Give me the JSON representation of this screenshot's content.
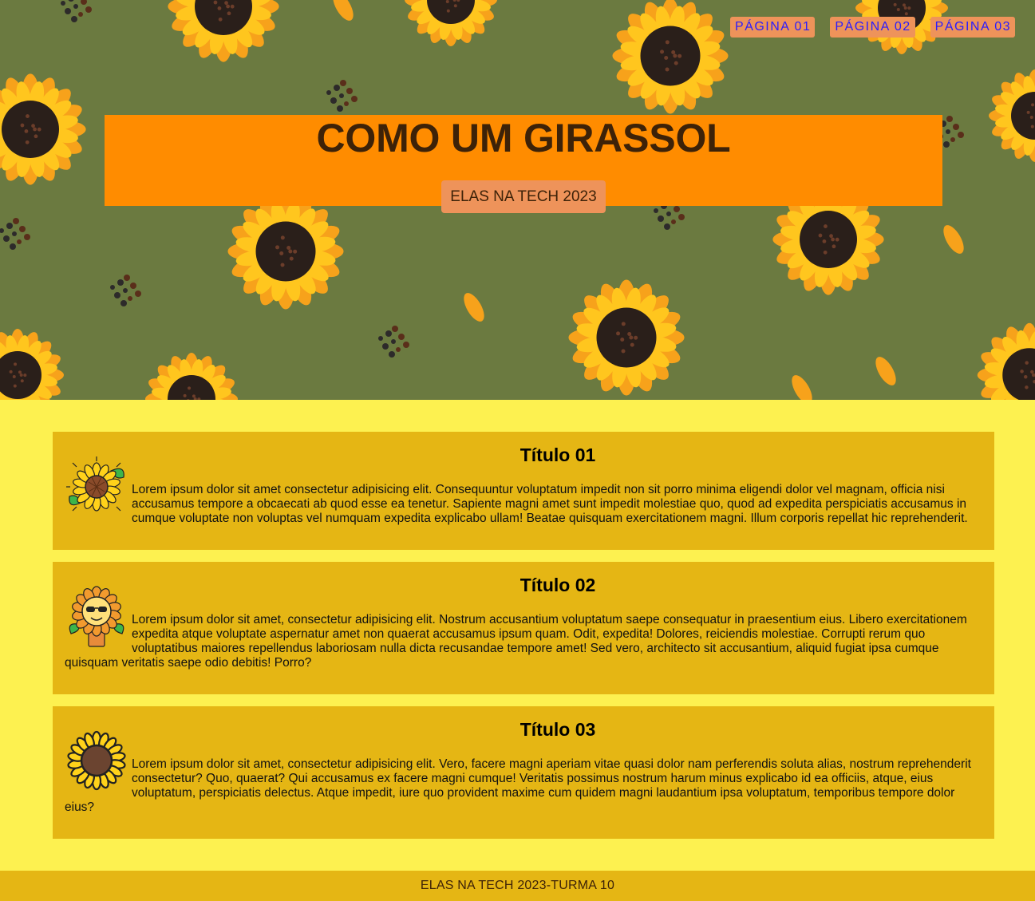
{
  "nav": [
    "PÁGINA 01",
    "PÁGINA 02",
    "PÁGINA 03"
  ],
  "hero": {
    "title": "COMO UM GIRASSOL",
    "badge": "ELAS NA TECH 2023"
  },
  "cards": [
    {
      "title": "Título 01",
      "icon": "sunflower-sparkle-icon",
      "text": "Lorem ipsum dolor sit amet consectetur adipisicing elit. Consequuntur voluptatum impedit non sit porro minima eligendi dolor vel magnam, officia nisi accusamus tempore a obcaecati ab quod esse ea tenetur. Sapiente magni amet sunt impedit molestiae quo, quod ad expedita perspiciatis accusamus in cumque voluptate non voluptas vel numquam expedita explicabo ullam! Beatae quisquam exercitationem magni. Illum corporis repellat hic reprehenderit."
    },
    {
      "title": "Título 02",
      "icon": "sunflower-sunglasses-pot-icon",
      "text": "Lorem ipsum dolor sit amet, consectetur adipisicing elit. Nostrum accusantium voluptatum saepe consequatur in praesentium eius. Libero exercitationem expedita atque voluptate aspernatur amet non quaerat accusamus ipsum quam. Odit, expedita! Dolores, reiciendis molestiae. Corrupti rerum quo voluptatibus maiores repellendus laboriosam nulla dicta recusandae tempore amet! Sed vero, architecto sit accusantium, aliquid fugiat ipsa cumque quisquam veritatis saepe odio debitis! Porro?"
    },
    {
      "title": "Título 03",
      "icon": "sunflower-outline-icon",
      "text": "Lorem ipsum dolor sit amet, consectetur adipisicing elit. Vero, facere magni aperiam vitae quasi dolor nam perferendis soluta alias, nostrum reprehenderit consectetur? Quo, quaerat? Qui accusamus ex facere magni cumque! Veritatis possimus nostrum harum minus explicabo id ea officiis, atque, eius voluptatum, perspiciatis delectus. Atque impedit, iure quo provident maxime cum quidem magni laudantium ipsa voluptatum, temporibus tempore dolor eius?"
    }
  ],
  "footer": "ELAS NA TECH 2023-TURMA 10",
  "colors": {
    "hero_background": "#6b7a40",
    "banner": "#ff8c00",
    "badge": "#ee935a",
    "page_background": "#fdf150",
    "card": "#e5b614",
    "nav_link": "#2a1cff"
  }
}
